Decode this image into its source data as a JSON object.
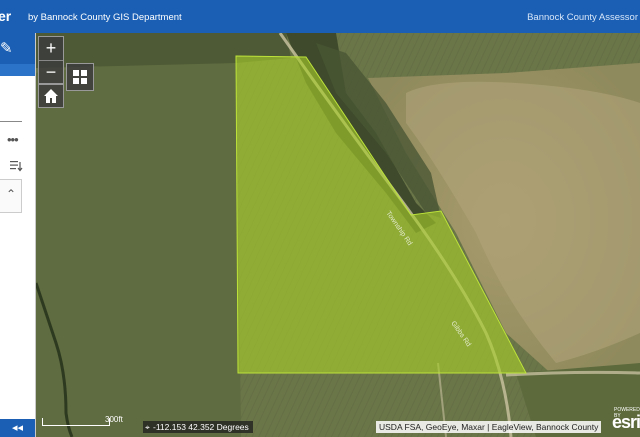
{
  "header": {
    "app_title": "er",
    "subtitle": "by Bannock County GIS Department",
    "right_link": "Bannock County Assessor"
  },
  "map": {
    "zoom_in": "+",
    "zoom_out": "−",
    "scale_label": "300ft",
    "coordinates": "-112.153 42.352 Degrees",
    "attribution": "USDA FSA, GeoEye, Maxar | EagleView, Bannock County",
    "logo": "esri",
    "logo_small": "POWERED BY",
    "road_label_1": "Township Rd",
    "road_label_2": "Gibbs Rd",
    "parcel_color": "#a8cf2a"
  },
  "sidepanel": {
    "footer_label": "◂◂",
    "more_label": "•••"
  },
  "icons": [
    "pencil-icon",
    "more-icon",
    "sort-icon",
    "chevron-up-icon",
    "grid-icon",
    "home-icon",
    "crosshair-icon"
  ]
}
